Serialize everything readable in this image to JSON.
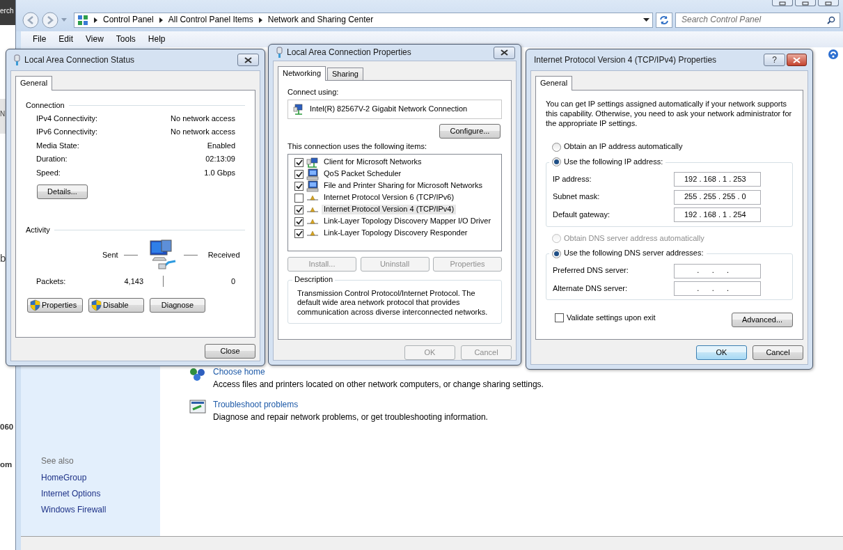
{
  "background_window": {
    "fragments": [
      {
        "text": "erch",
        "kind": "dark"
      },
      {
        "text": "N",
        "kind": "grey"
      },
      {
        "text": "b",
        "kind": "plain"
      },
      {
        "text": "060",
        "kind": "bold"
      },
      {
        "text": "om",
        "kind": "bold"
      }
    ]
  },
  "explorer": {
    "breadcrumb": [
      "Control Panel",
      "All Control Panel Items",
      "Network and Sharing Center"
    ],
    "search": {
      "placeholder": "Search Control Panel"
    },
    "menu": [
      "File",
      "Edit",
      "View",
      "Tools",
      "Help"
    ],
    "see_also": {
      "title": "See also",
      "links": [
        "HomeGroup",
        "Internet Options",
        "Windows Firewall"
      ]
    },
    "tasks": [
      {
        "kind": "homegroup",
        "title": "Choose home",
        "description": "Access files and printers located on other network computers, or change sharing settings."
      },
      {
        "kind": "troubleshoot",
        "title": "Troubleshoot problems",
        "description": "Diagnose and repair network problems, or get troubleshooting information."
      }
    ]
  },
  "status_dialog": {
    "title": "Local Area Connection Status",
    "tabs": [
      {
        "label": "General",
        "selected": true
      }
    ],
    "connection": {
      "heading": "Connection",
      "rows": [
        {
          "label": "IPv4 Connectivity:",
          "value": "No network access"
        },
        {
          "label": "IPv6 Connectivity:",
          "value": "No network access"
        },
        {
          "label": "Media State:",
          "value": "Enabled"
        },
        {
          "label": "Duration:",
          "value": "02:13:09"
        },
        {
          "label": "Speed:",
          "value": "1.0 Gbps"
        }
      ]
    },
    "details_button": "Details...",
    "activity": {
      "heading": "Activity",
      "sent_label": "Sent",
      "received_label": "Received",
      "packets_label": "Packets:",
      "sent": "4,143",
      "received": "0"
    },
    "buttons": [
      {
        "label": "Properties",
        "shield": true
      },
      {
        "label": "Disable",
        "shield": true
      },
      {
        "label": "Diagnose",
        "shield": false
      }
    ],
    "close_button": "Close"
  },
  "properties_dialog": {
    "title": "Local Area Connection Properties",
    "tabs": [
      {
        "label": "Networking",
        "selected": true
      },
      {
        "label": "Sharing",
        "selected": false
      }
    ],
    "connect_using_label": "Connect using:",
    "adapter": "Intel(R) 82567V-2 Gigabit Network Connection",
    "configure_button": "Configure...",
    "items_label": "This connection uses the following items:",
    "items": [
      {
        "kind": "client",
        "label": "Client for Microsoft Networks",
        "checked": true,
        "selected": false
      },
      {
        "kind": "service",
        "label": "QoS Packet Scheduler",
        "checked": true,
        "selected": false
      },
      {
        "kind": "service",
        "label": "File and Printer Sharing for Microsoft Networks",
        "checked": true,
        "selected": false
      },
      {
        "kind": "protocol",
        "label": "Internet Protocol Version 6 (TCP/IPv6)",
        "checked": false,
        "selected": false
      },
      {
        "kind": "protocol",
        "label": "Internet Protocol Version 4 (TCP/IPv4)",
        "checked": true,
        "selected": true
      },
      {
        "kind": "protocol",
        "label": "Link-Layer Topology Discovery Mapper I/O Driver",
        "checked": true,
        "selected": false
      },
      {
        "kind": "protocol",
        "label": "Link-Layer Topology Discovery Responder",
        "checked": true,
        "selected": false
      }
    ],
    "buttons": [
      {
        "label": "Install...",
        "disabled": true
      },
      {
        "label": "Uninstall",
        "disabled": true
      },
      {
        "label": "Properties",
        "disabled": true
      }
    ],
    "description": {
      "heading": "Description",
      "text": "Transmission Control Protocol/Internet Protocol. The default wide area network protocol that provides communication across diverse interconnected networks."
    },
    "footer_buttons": [
      {
        "label": "OK",
        "disabled": true
      },
      {
        "label": "Cancel",
        "disabled": true
      }
    ]
  },
  "ipv4_dialog": {
    "title": "Internet Protocol Version 4 (TCP/IPv4) Properties",
    "help_button": "?",
    "tabs": [
      {
        "label": "General",
        "selected": true
      }
    ],
    "intro": "You can get IP settings assigned automatically if your network supports this capability. Otherwise, you need to ask your network administrator for the appropriate IP settings.",
    "ip_options": [
      {
        "label": "Obtain an IP address automatically",
        "selected": false,
        "disabled": false
      },
      {
        "label": "Use the following IP address:",
        "selected": true,
        "disabled": false
      }
    ],
    "ip_fields": [
      {
        "label": "IP address:",
        "value": "192 . 168 . 1 . 253"
      },
      {
        "label": "Subnet mask:",
        "value": "255 . 255 . 255 . 0"
      },
      {
        "label": "Default gateway:",
        "value": "192 . 168 . 1 . 254"
      }
    ],
    "dns_options": [
      {
        "label": "Obtain DNS server address automatically",
        "selected": false,
        "disabled": true
      },
      {
        "label": "Use the following DNS server addresses:",
        "selected": true,
        "disabled": false
      }
    ],
    "dns_fields": [
      {
        "label": "Preferred DNS server:",
        "value": "      .      .      ."
      },
      {
        "label": "Alternate DNS server:",
        "value": "      .      .      ."
      }
    ],
    "validate": {
      "label": "Validate settings upon exit",
      "checked": false
    },
    "advanced_button": "Advanced...",
    "footer_buttons": [
      {
        "label": "OK",
        "default": true
      },
      {
        "label": "Cancel",
        "default": false
      }
    ]
  }
}
